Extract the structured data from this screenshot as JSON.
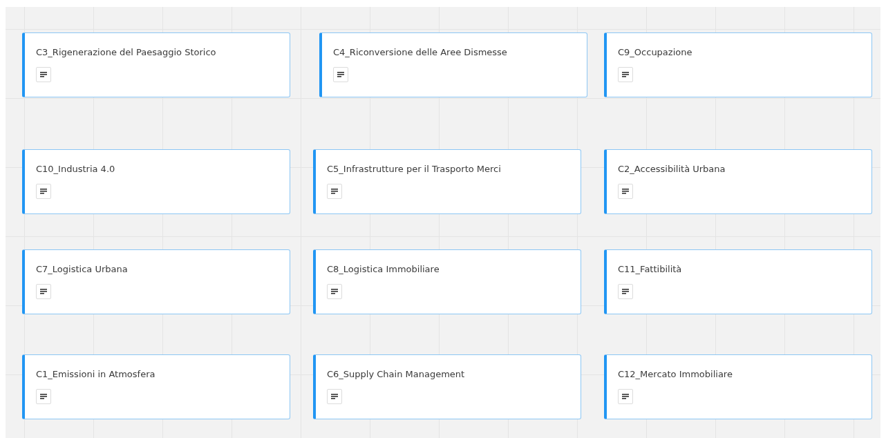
{
  "board": {
    "rows": [
      {
        "cards": [
          {
            "title": "C3_Rigenerazione del Paesaggio Storico"
          },
          {
            "title": "C4_Riconversione delle Aree Dismesse"
          },
          {
            "title": "C9_Occupazione"
          }
        ]
      },
      {
        "cards": [
          {
            "title": "C10_Industria 4.0"
          },
          {
            "title": "C5_Infrastrutture per il Trasporto Merci"
          },
          {
            "title": "C2_Accessibilità Urbana"
          }
        ]
      },
      {
        "cards": [
          {
            "title": "C7_Logistica Urbana"
          },
          {
            "title": "C8_Logistica Immobiliare"
          },
          {
            "title": "C11_Fattibilità"
          }
        ]
      },
      {
        "cards": [
          {
            "title": "C1_Emissioni in Atmosfera"
          },
          {
            "title": "C6_Supply Chain Management"
          },
          {
            "title": "C12_Mercato Immobiliare"
          }
        ]
      }
    ]
  }
}
